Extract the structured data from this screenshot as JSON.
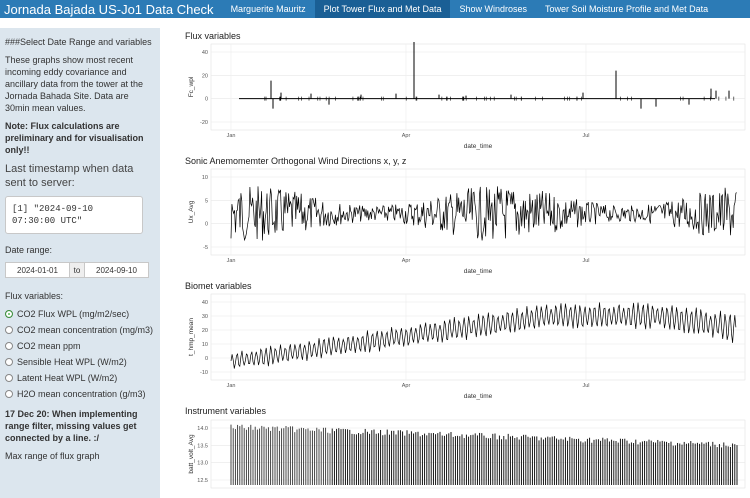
{
  "navbar": {
    "brand": "Jornada Bajada US-Jo1 Data Check",
    "links": [
      "Marguerite Mauritz",
      "Plot Tower Flux and Met Data",
      "Show Windroses",
      "Tower Soil Moisture Profile and Met Data"
    ],
    "active_index": 1
  },
  "sidebar": {
    "heading": "###Select Date Range and variables",
    "intro": "These graphs show most recent incoming eddy covariance and ancillary data from the tower at the Jornada Bahada Site. Data are 30min mean values.",
    "note": "Note: Flux calculations are preliminary and for visualisation only!!",
    "last_ts_label": "Last timestamp when data sent to server:",
    "last_ts_value": "[1] \"2024-09-10 07:30:00 UTC\"",
    "date_range_label": "Date range:",
    "date_start": "2024-01-01",
    "date_to": "to",
    "date_end": "2024-09-10",
    "flux_label": "Flux variables:",
    "flux_options": [
      "CO2 Flux WPL (mg/m2/sec)",
      "CO2 mean concentration (mg/m3)",
      "CO2 mean ppm",
      "Sensible Heat WPL (W/m2)",
      "Latent Heat WPL (W/m2)",
      "H2O mean concentration (g/m3)"
    ],
    "flux_selected": 0,
    "dev_note": "17 Dec 20: When implementing range filter, missing values get connected by a line. :/",
    "truncated": "Max range of flux graph"
  },
  "panels": [
    {
      "title": "Flux variables",
      "ylabel": "Fc_wpl",
      "xlabel": "date_time",
      "yticks": [
        "40",
        "20",
        "0",
        "-20"
      ],
      "xticks": [
        "Jan",
        "Apr",
        "Jul"
      ]
    },
    {
      "title": "Sonic Anemomemter Orthogonal Wind Directions x, y, z",
      "ylabel": "Ux_Avg",
      "xlabel": "date_time",
      "yticks": [
        "10",
        "5",
        "0",
        "-5"
      ],
      "xticks": [
        "Jan",
        "Apr",
        "Jul"
      ]
    },
    {
      "title": "Biomet variables",
      "ylabel": "t_hmp_mean",
      "xlabel": "date_time",
      "yticks": [
        "40",
        "30",
        "20",
        "10",
        "0",
        "-10"
      ],
      "xticks": [
        "Jan",
        "Apr",
        "Jul"
      ]
    },
    {
      "title": "Instrument variables",
      "ylabel": "batt_volt_Avg",
      "xlabel": "",
      "yticks": [
        "14.0",
        "13.5",
        "13.0",
        "12.5"
      ],
      "xticks": []
    }
  ],
  "colors": {
    "navbar": "#2c7bb6",
    "navbar_active": "#1a5f95",
    "sidebar": "#dce6ee",
    "radio_selected": "#5cb85c"
  }
}
